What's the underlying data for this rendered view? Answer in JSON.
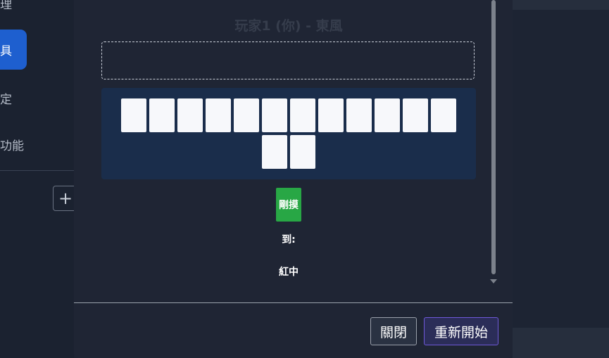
{
  "sidebar": {
    "items": [
      {
        "label": "理"
      },
      {
        "label": "具"
      },
      {
        "label": "定"
      },
      {
        "label": "功能"
      }
    ],
    "add_label": "+"
  },
  "modal": {
    "title": "玩家1 (你) - 東風",
    "hand_tile_count": 14,
    "drawn_tile_label": "剛摸",
    "drawn_to_label": "到:",
    "drawn_tile_value": "紅中",
    "buttons": {
      "close": "關閉",
      "restart": "重新開始"
    }
  },
  "colors": {
    "modal_bg": "#1f2534",
    "hand_bg": "#1a2d4b",
    "drawn_tile": "#28a745",
    "sidebar_active": "#1e5fcf",
    "restart_border": "#6f59d9"
  }
}
